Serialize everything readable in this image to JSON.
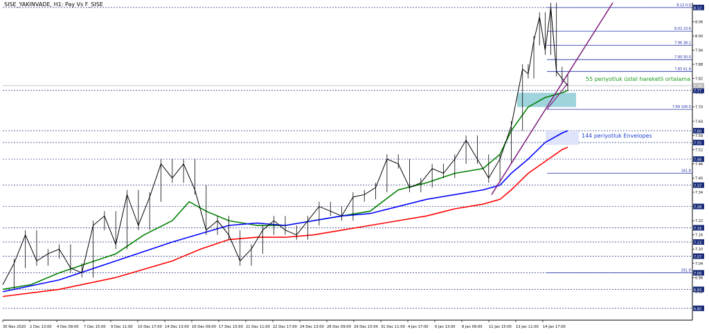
{
  "chart_data": {
    "type": "candlestick",
    "title": "SISE_YAKINVADE, H1: Pay Vs F_SISE",
    "ylim": [
      6.8,
      8.14
    ],
    "grid": false,
    "y_ticks": [
      6.85,
      6.92,
      6.98,
      7.04,
      7.1,
      7.16,
      7.22,
      7.28,
      7.34,
      7.4,
      7.46,
      7.52,
      7.58,
      7.64,
      7.7,
      7.76,
      7.82,
      7.88,
      7.94,
      8.0,
      8.06,
      8.12
    ],
    "x_ticks": [
      "30 Nov 2020",
      "2 Dec 13:00",
      "4 Dec 09:00",
      "7 Dec 15:00",
      "9 Dec 11:00",
      "10 Dec 17:00",
      "14 Dec 13:00",
      "16 Dec 09:00",
      "17 Dec 15:00",
      "21 Dec 11:00",
      "22 Dec 17:00",
      "24 Dec 13:00",
      "28 Dec 09:00",
      "29 Dec 15:00",
      "31 Dec 11:00",
      "4 Jan 17:00",
      "6 Jan 13:00",
      "8 Jan 09:00",
      "11 Jan 15:00",
      "13 Jan 11:00",
      "14 Jan 17:00"
    ],
    "price_lines": [
      {
        "value": 8.12,
        "label": "8.12"
      },
      {
        "value": 7.77,
        "label": "7.77"
      },
      {
        "value": 7.6,
        "label": "7.60"
      },
      {
        "value": 7.55,
        "label": "7.55"
      },
      {
        "value": 7.48,
        "label": "7.48"
      },
      {
        "value": 7.37,
        "label": "7.37"
      },
      {
        "value": 7.28,
        "label": "7.28"
      },
      {
        "value": 7.19,
        "label": "7.19"
      },
      {
        "value": 7.13,
        "label": "7.13"
      },
      {
        "value": 7.07,
        "label": "7.07"
      },
      {
        "value": 7.0,
        "label": "7.00"
      },
      {
        "value": 6.93,
        "label": "6.93"
      },
      {
        "value": 6.85,
        "label": "6.85"
      }
    ],
    "bid_line": {
      "value": 7.79,
      "label": "7.79"
    },
    "fib_levels": [
      {
        "value": 8.12,
        "label": "8.12 0.0"
      },
      {
        "value": 8.02,
        "label": "8.02 23.6"
      },
      {
        "value": 7.96,
        "label": "7.96 38.2"
      },
      {
        "value": 7.9,
        "label": "7.90 50.0"
      },
      {
        "value": 7.85,
        "label": "7.85 61.8"
      },
      {
        "value": 7.69,
        "label": "7.69 100.0"
      },
      {
        "value": 7.42,
        "label": "161.8"
      },
      {
        "value": 7.0,
        "label": "261.8"
      }
    ],
    "annotations": [
      {
        "text": "55 periyotluk üstel hareketli ortalama",
        "color": "#1a9a1a"
      },
      {
        "text": "144 periyotluk Envelopes",
        "color": "#1e3fd0"
      }
    ],
    "series": [
      {
        "key": "ema55",
        "color": "#008000",
        "x": [
          0,
          0.05,
          0.1,
          0.15,
          0.2,
          0.25,
          0.3,
          0.33,
          0.36,
          0.4,
          0.45,
          0.5,
          0.55,
          0.6,
          0.65,
          0.7,
          0.75,
          0.8,
          0.85,
          0.88,
          0.9,
          0.93,
          0.96,
          0.99,
          1.0
        ],
        "values": [
          6.93,
          6.95,
          7.0,
          7.04,
          7.08,
          7.16,
          7.22,
          7.3,
          7.26,
          7.22,
          7.2,
          7.2,
          7.22,
          7.24,
          7.26,
          7.35,
          7.38,
          7.42,
          7.44,
          7.5,
          7.6,
          7.7,
          7.74,
          7.76,
          7.77
        ]
      },
      {
        "key": "env_upper",
        "color": "#0000ff",
        "x": [
          0,
          0.1,
          0.2,
          0.3,
          0.4,
          0.45,
          0.5,
          0.55,
          0.6,
          0.65,
          0.7,
          0.75,
          0.8,
          0.85,
          0.88,
          0.9,
          0.93,
          0.96,
          0.99,
          1.0
        ],
        "values": [
          6.92,
          6.97,
          7.05,
          7.13,
          7.2,
          7.21,
          7.2,
          7.22,
          7.24,
          7.25,
          7.28,
          7.31,
          7.33,
          7.35,
          7.37,
          7.42,
          7.48,
          7.55,
          7.59,
          7.6
        ]
      },
      {
        "key": "env_lower",
        "color": "#ff0000",
        "x": [
          0,
          0.1,
          0.2,
          0.3,
          0.35,
          0.4,
          0.45,
          0.5,
          0.55,
          0.6,
          0.65,
          0.7,
          0.75,
          0.8,
          0.85,
          0.88,
          0.9,
          0.93,
          0.96,
          0.99,
          1.0
        ],
        "values": [
          6.9,
          6.93,
          6.98,
          7.05,
          7.1,
          7.14,
          7.15,
          7.15,
          7.16,
          7.18,
          7.2,
          7.22,
          7.24,
          7.27,
          7.29,
          7.31,
          7.35,
          7.42,
          7.47,
          7.52,
          7.53
        ]
      },
      {
        "key": "price",
        "color": "#000000",
        "x": [
          0,
          0.02,
          0.04,
          0.06,
          0.08,
          0.1,
          0.12,
          0.14,
          0.16,
          0.18,
          0.2,
          0.22,
          0.24,
          0.26,
          0.28,
          0.3,
          0.32,
          0.34,
          0.36,
          0.38,
          0.4,
          0.42,
          0.44,
          0.46,
          0.48,
          0.5,
          0.52,
          0.54,
          0.56,
          0.58,
          0.6,
          0.62,
          0.64,
          0.66,
          0.68,
          0.7,
          0.72,
          0.74,
          0.76,
          0.78,
          0.8,
          0.82,
          0.84,
          0.86,
          0.88,
          0.9,
          0.92,
          0.93,
          0.94,
          0.95,
          0.96,
          0.97,
          0.98,
          0.99,
          1.0
        ],
        "values": [
          6.95,
          7.04,
          7.16,
          7.05,
          7.08,
          7.1,
          7.02,
          7.0,
          7.2,
          7.24,
          7.12,
          7.33,
          7.2,
          7.32,
          7.46,
          7.4,
          7.46,
          7.35,
          7.18,
          7.22,
          7.16,
          7.05,
          7.1,
          7.18,
          7.22,
          7.18,
          7.16,
          7.22,
          7.28,
          7.26,
          7.24,
          7.32,
          7.33,
          7.36,
          7.48,
          7.46,
          7.36,
          7.38,
          7.44,
          7.42,
          7.48,
          7.56,
          7.48,
          7.4,
          7.48,
          7.62,
          7.86,
          7.84,
          7.98,
          8.08,
          7.94,
          8.12,
          7.85,
          7.82,
          7.79
        ]
      }
    ]
  }
}
